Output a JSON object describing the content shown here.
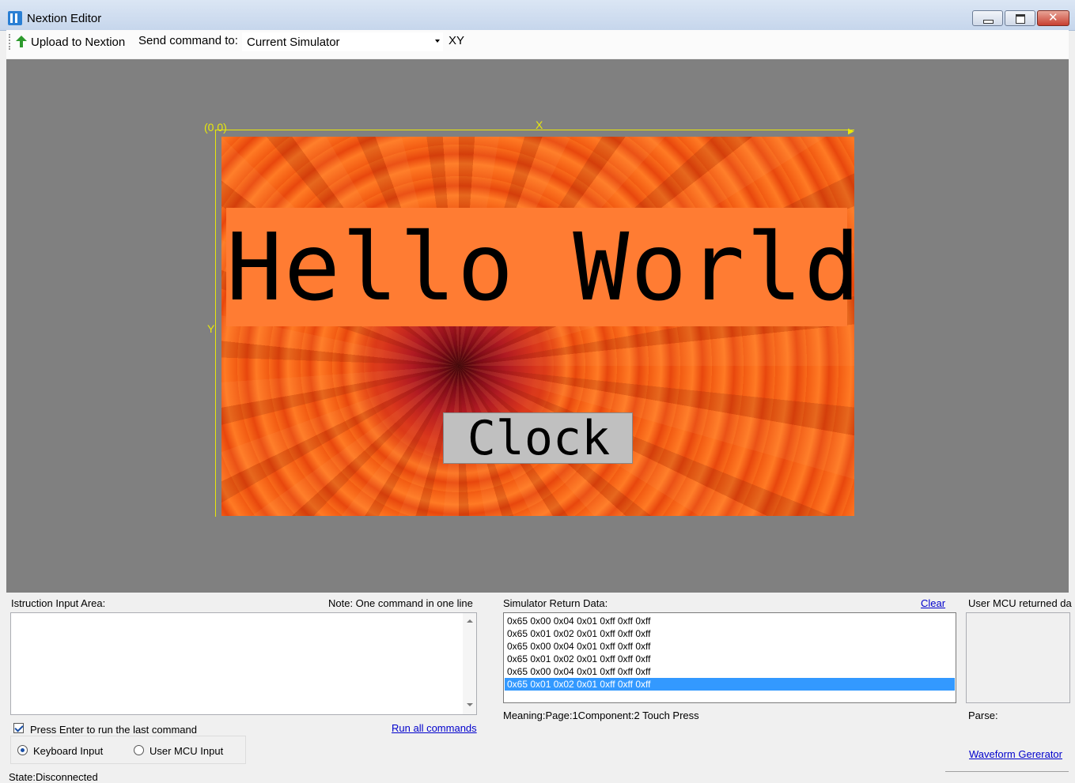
{
  "window": {
    "title": "Nextion Editor",
    "minimize_icon": "minimize-icon",
    "maximize_icon": "maximize-icon",
    "close_glyph": "✕"
  },
  "toolbar": {
    "upload_label": "Upload to Nextion",
    "upload_icon": "green-up-arrow-icon",
    "send_label": "Send command to:",
    "send_target": "Current Simulator",
    "xy_label": "XY"
  },
  "canvas": {
    "origin_label": "(0,0)",
    "x_axis_label": "X",
    "y_axis_label": "Y",
    "axis_color": "#e8e80a",
    "background_color": "#808080",
    "screen": {
      "background_image": "orange chrysanthemum flower",
      "hello_text": "Hello World!!!",
      "hello_bg_color": "#ff7c33",
      "clock_button_label": "Clock",
      "clock_button_color": "#c0c0c0"
    }
  },
  "instruction_panel": {
    "label": "Istruction Input Area:",
    "note": "Note: One command in one line",
    "input_value": "",
    "press_enter_label": "Press Enter to run the last command",
    "press_enter_checked": true,
    "run_all_label": "Run all commands",
    "keyboard_input_label": "Keyboard Input",
    "user_mcu_input_label": "User MCU Input",
    "selected_input": "Keyboard Input"
  },
  "simulator_panel": {
    "label": "Simulator Return Data:",
    "clear_label": "Clear",
    "rows": [
      "0x65 0x00 0x04 0x01 0xff 0xff 0xff",
      "0x65 0x01 0x02 0x01 0xff 0xff 0xff",
      "0x65 0x00 0x04 0x01 0xff 0xff 0xff",
      "0x65 0x01 0x02 0x01 0xff 0xff 0xff",
      "0x65 0x00 0x04 0x01 0xff 0xff 0xff",
      "0x65 0x01 0x02 0x01 0xff 0xff 0xff"
    ],
    "selected_row": 5,
    "selection_color": "#3399ff",
    "meaning": "Meaning:Page:1Component:2 Touch Press"
  },
  "mcu_panel": {
    "label": "User MCU returned da",
    "parse_label": "Parse:",
    "waveform_label": "Waveform Gererator"
  },
  "status": {
    "state": "State:Disconnected"
  }
}
